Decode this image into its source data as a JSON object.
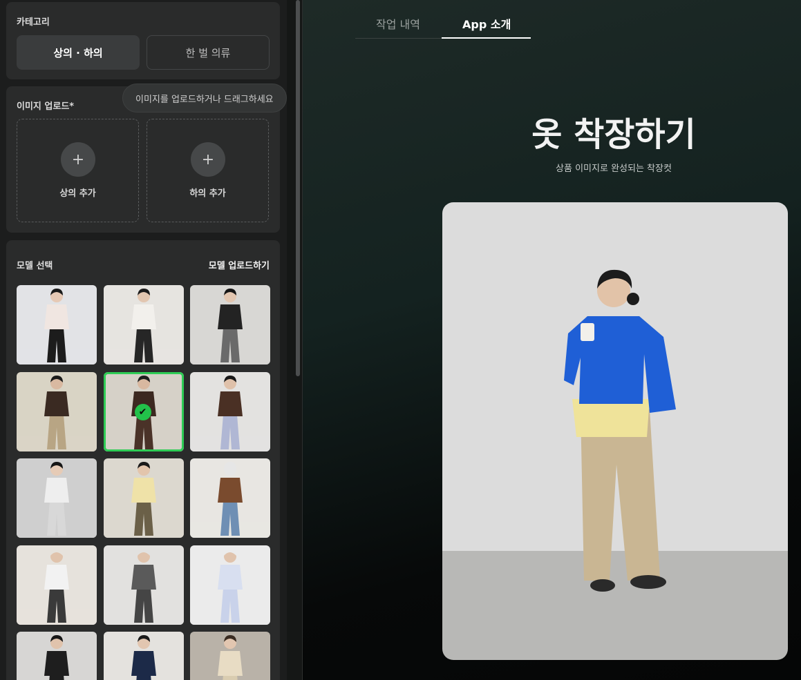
{
  "sidebar": {
    "category": {
      "title": "카테고리",
      "options": [
        "상의 · 하의",
        "한 벌 의류"
      ],
      "selected": "상의 · 하의"
    },
    "upload": {
      "title": "이미지 업로드*",
      "tooltip": "이미지를 업로드하거나 드래그하세요",
      "top_label": "상의 추가",
      "bottom_label": "하의 추가",
      "plus": "+"
    },
    "models": {
      "title": "모델 선택",
      "upload_button": "모델 업로드하기",
      "selected_index": 4,
      "check": "✔",
      "thumbs": [
        {
          "bg": "#e2e3e6",
          "top": "#f0e6e1",
          "bottom": "#1c1c1c",
          "skin": "#e6c9b5",
          "hair": "#1a1a1a"
        },
        {
          "bg": "#e6e4e0",
          "top": "#f2f0ec",
          "bottom": "#262626",
          "skin": "#e2c6b0",
          "hair": "#1c1c1c"
        },
        {
          "bg": "#d8d7d4",
          "top": "#232323",
          "bottom": "#6a6a6a",
          "skin": "#e2c6b0",
          "hair": "#151515"
        },
        {
          "bg": "#d9d4c5",
          "top": "#3a2a22",
          "bottom": "#b8a584",
          "skin": "#d9b9a1",
          "hair": "#1a1a1a"
        },
        {
          "bg": "#d6d1c8",
          "top": "#3c2820",
          "bottom": "#4a3228",
          "skin": "#d8b8a0",
          "hair": "#1e1e1e"
        },
        {
          "bg": "#e3e2e0",
          "top": "#4a3024",
          "bottom": "#b0b7d4",
          "skin": "#dfc1aa",
          "hair": "#181818"
        },
        {
          "bg": "#cfcfcf",
          "top": "#eeeeee",
          "bottom": "#d8d8d8",
          "skin": "#e6cbb6",
          "hair": "#161616"
        },
        {
          "bg": "#dcd8cf",
          "top": "#efe2a8",
          "bottom": "#6b6048",
          "skin": "#e3c5ac",
          "hair": "#1a1a1a"
        },
        {
          "bg": "#e8e6e2",
          "top": "#7a4b2e",
          "bottom": "#6f8fb4",
          "skin": "#e6e6e6",
          "hair": "#e6e6e6"
        },
        {
          "bg": "#e6e2dc",
          "top": "#f2f2f2",
          "bottom": "#3a3a3a",
          "skin": "#e0c3ac",
          "hair": "#e6e2dc"
        },
        {
          "bg": "#e2e1df",
          "top": "#5a5a5a",
          "bottom": "#454545",
          "skin": "#e0c3ac",
          "hair": "#e2e1df"
        },
        {
          "bg": "#ebebeb",
          "top": "#d8dff0",
          "bottom": "#c9d2ea",
          "skin": "#e0c3ac",
          "hair": "#ebebeb"
        },
        {
          "bg": "#d7d6d4",
          "top": "#1e1e1e",
          "bottom": "#1e1e1e",
          "skin": "#e0c3ac",
          "hair": "#161616"
        },
        {
          "bg": "#e4e2de",
          "top": "#1c2a48",
          "bottom": "#1c2a48",
          "skin": "#e2c6b0",
          "hair": "#1a1a1a"
        },
        {
          "bg": "#b9b2a8",
          "top": "#e8dcc4",
          "bottom": "#d9ccb0",
          "skin": "#e2c6b0",
          "hair": "#3a2c22"
        }
      ]
    }
  },
  "main": {
    "tabs": [
      "작업 내역",
      "App 소개"
    ],
    "active_tab": "App 소개",
    "hero": {
      "title": "옷 착장하기",
      "subtitle": "상품 이미지로 완성되는 착장컷",
      "image": {
        "sweater": "#1f5fd6",
        "shirt": "#efe39a",
        "pants": "#c9b693",
        "wall": "#dcdcdc",
        "floor": "#b8b8b6"
      }
    }
  }
}
